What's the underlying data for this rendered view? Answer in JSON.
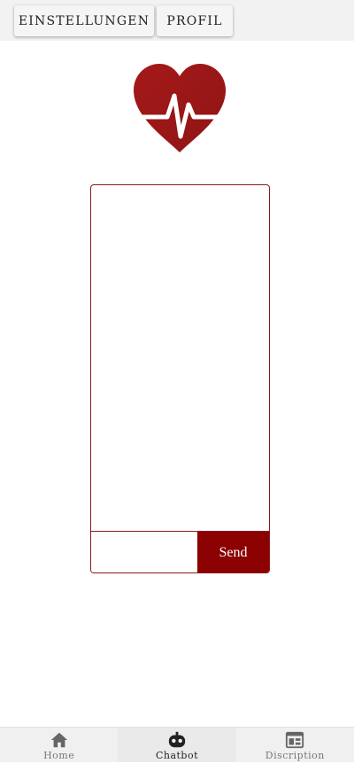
{
  "header": {
    "settings_label": "EINSTELLUNGEN",
    "profile_label": "PROFIL"
  },
  "logo": {
    "icon": "heart-pulse-icon",
    "color": "#a01818"
  },
  "chat": {
    "input_value": "",
    "send_label": "Send",
    "accent": "#8b0000"
  },
  "bottom_nav": {
    "items": [
      {
        "label": "Home",
        "icon": "home-icon",
        "active": false
      },
      {
        "label": "Chatbot",
        "icon": "robot-icon",
        "active": true
      },
      {
        "label": "Discription",
        "icon": "calendar-icon",
        "active": false
      }
    ]
  }
}
